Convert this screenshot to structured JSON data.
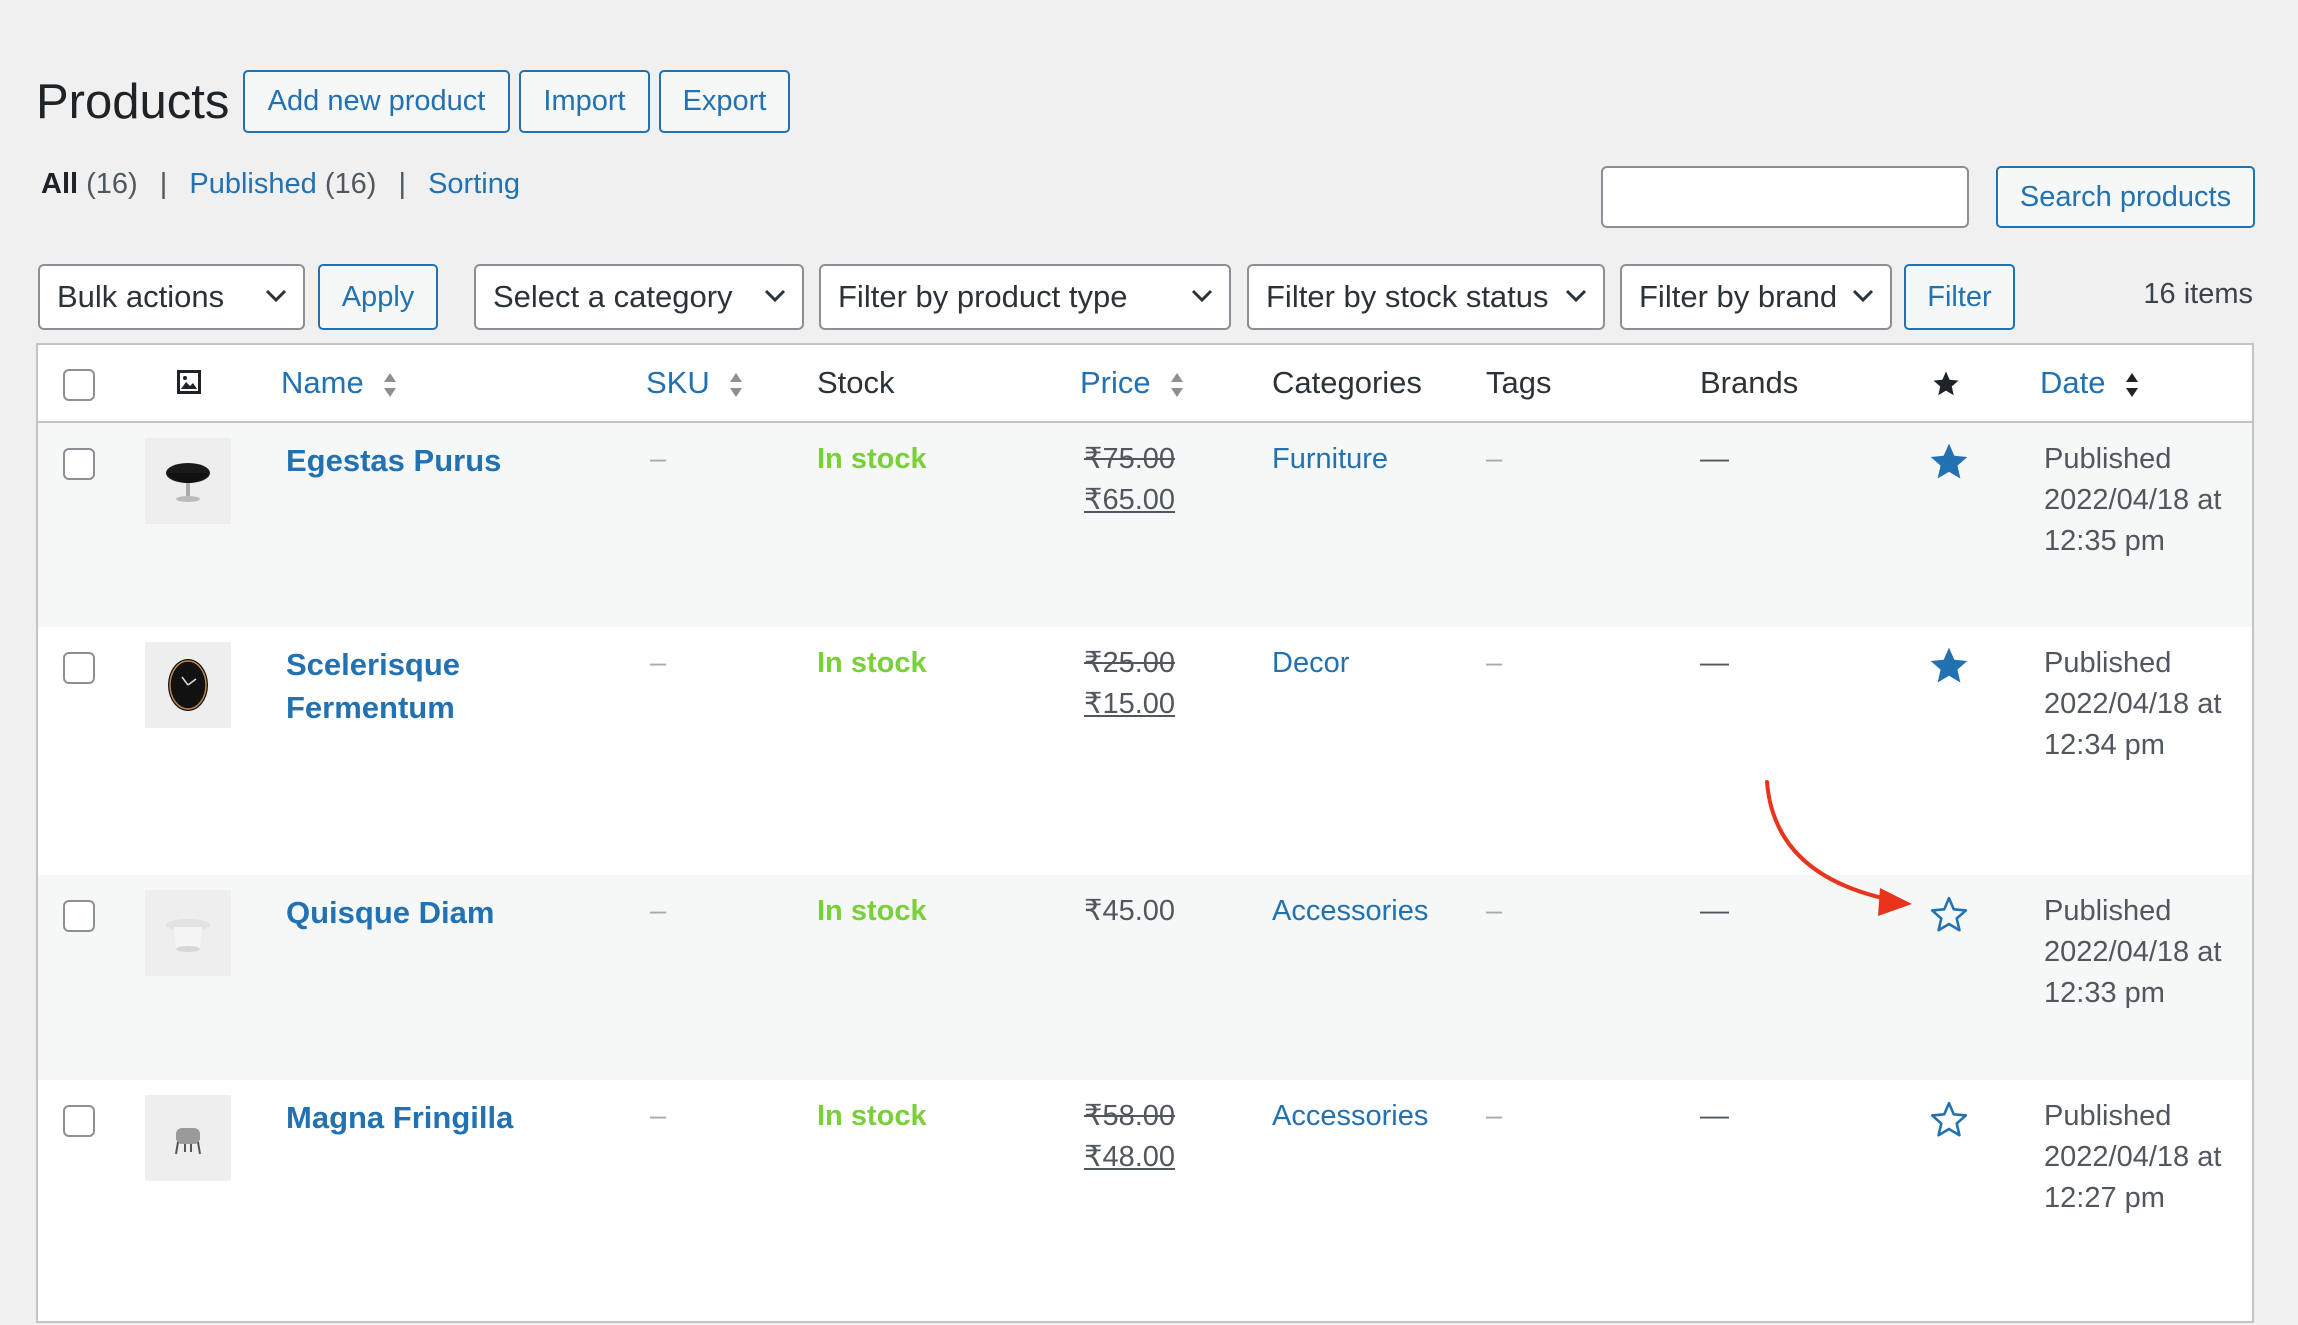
{
  "page": {
    "title": "Products",
    "add_new_label": "Add new product",
    "import_label": "Import",
    "export_label": "Export"
  },
  "views": {
    "all_label": "All",
    "all_count": "(16)",
    "published_label": "Published",
    "published_count": "(16)",
    "sorting_label": "Sorting",
    "separator": "|"
  },
  "search": {
    "value": "",
    "button_label": "Search products"
  },
  "filters": {
    "bulk_actions": "Bulk actions",
    "apply_label": "Apply",
    "category": "Select a category",
    "product_type": "Filter by product type",
    "stock_status": "Filter by stock status",
    "brand": "Filter by brand",
    "filter_label": "Filter",
    "items_count": "16 items"
  },
  "columns": {
    "name": "Name",
    "sku": "SKU",
    "stock": "Stock",
    "price": "Price",
    "categories": "Categories",
    "tags": "Tags",
    "brands": "Brands",
    "featured_icon": "star-icon",
    "date": "Date"
  },
  "rows": [
    {
      "name_line1": "Egestas Purus",
      "name_line2": "",
      "thumb": "black-swivel-chair",
      "sku": "–",
      "stock": "In stock",
      "price_old": "₹75.00",
      "price_new": "₹65.00",
      "price": "",
      "category": "Furniture",
      "tags": "–",
      "brands": "—",
      "featured": true,
      "date_status": "Published",
      "date_line": "2022/04/18 at",
      "date_time": "12:35 pm"
    },
    {
      "name_line1": "Scelerisque",
      "name_line2": "Fermentum",
      "thumb": "black-wall-clock",
      "sku": "–",
      "stock": "In stock",
      "price_old": "₹25.00",
      "price_new": "₹15.00",
      "price": "",
      "category": "Decor",
      "tags": "–",
      "brands": "—",
      "featured": true,
      "date_status": "Published",
      "date_line": "2022/04/18 at",
      "date_time": "12:34 pm"
    },
    {
      "name_line1": "Quisque Diam",
      "name_line2": "",
      "thumb": "white-side-table",
      "sku": "–",
      "stock": "In stock",
      "price_old": "",
      "price_new": "",
      "price": "₹45.00",
      "category": "Accessories",
      "tags": "–",
      "brands": "—",
      "featured": false,
      "date_status": "Published",
      "date_line": "2022/04/18 at",
      "date_time": "12:33 pm"
    },
    {
      "name_line1": "Magna Fringilla",
      "name_line2": "",
      "thumb": "grey-stool",
      "sku": "–",
      "stock": "In stock",
      "price_old": "₹58.00",
      "price_new": "₹48.00",
      "price": "",
      "category": "Accessories",
      "tags": "–",
      "brands": "—",
      "featured": false,
      "date_status": "Published",
      "date_line": "2022/04/18 at",
      "date_time": "12:27 pm"
    }
  ],
  "colors": {
    "accent": "#2271b1",
    "in_stock": "#7ad03a",
    "annotation_arrow": "#e8341c",
    "background": "#f0f0f1"
  },
  "annotation": {
    "icon": "red-curved-arrow"
  }
}
